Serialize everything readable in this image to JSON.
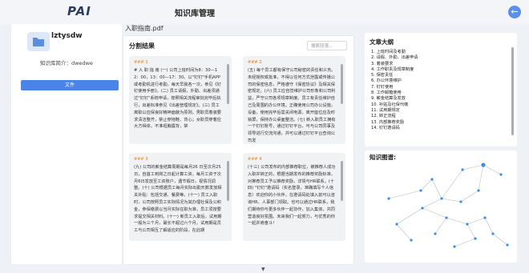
{
  "header": {
    "logo": "PAI",
    "title": "知识库管理",
    "back_icon": "arrow-left-icon"
  },
  "sidebar": {
    "kb_name": "lztysdw",
    "intro": "知识库简介：dwedwe",
    "file_button": "文件"
  },
  "main": {
    "file_name": "入职指南.pdf",
    "segment_title": "分割结果",
    "search_placeholder": "搜索段落...",
    "cards": [
      {
        "tag": "### 1",
        "text": "# 入 职 指 南 (一) 公司上班时间为8：30—12：00，13：00—17：30。以\"钉钉\"手机APP或考勤机进行考勤。每天早晨各一次，参见《钉钉使用手册》。(二) 员工请假，外勤、出差须通过\"钉钉\"系统申请，按照相关流程审批完毕后执行，出差标准参见《出差管理规定》。(三) 员工离职以应保良好精神面貌为原则。男职员着装要求清洁整齐，禁止穿拖鞋、背心；女职员穿着应大方得体，不准袒胸露背，禁"
      },
      {
        "tag": "### 2",
        "text": "(五) 每个员工都有保守公司秘密的责任和义务。未经授权或批准，不得以任何方式泄露或传播公司的保密信息，严格遵守《保密协议》及相关保密规定。(六) 员工应自觉维护公司形象和公司利益，严守公司各项规章制度。员工有责任维护自己及周围的办公环境。正确使用公司办公设施，设备，使用完毕后需关闭电源。离开座位应及时锁屏，保持办公桌面整洁。(七) 新入职员工拥有一个钉钉账号，通过钉钉平台，可与公司同事及领导进行交流沟通，并可以通过钉钉平台查询公司发"
      },
      {
        "tag": "### 3",
        "text": "(九) 公司的薪金结算周期是每月26 日至次月25 日，自首工到岗之日起计算工资，每月工资于次月6日发放至工资账户，遇节假日，视情况调整。(十) 公司根据员工每月实际出勤天数发放相关补贴：包括交通、餐费等。(十一) 员工入职时，公司按照员工实际情况为其办理社保及公积金，参保缴费以当月实际在职为准，员工须按要求提交相关材料。(十一) 新员工入职后，试用期一般为三个月，最长不超过六个月。试用期是员工与公司相互了解适应的阶段，在此期"
      },
      {
        "tag": "### 4",
        "text": "(十三) 公司发布的内部推荐职位，被推荐人成功入职并转正的，根据当期发布的推荐奖励标准，对推荐员工予以推荐奖励，详情与HR联系。(十四) \"钉钉\"邀请码（实名登录，准确填写个人信息）欢迎你的小伙伴，在邀请码处填入前可以咨询HR、人事部门领取。也可以通过HR联系，我们期待你与更多伙伴一起协作，加入集体，共同营造良好氛围。未来我们一起努力，与优秀的你一起并肩奋斗！"
      }
    ]
  },
  "outline": {
    "title": "文章大纲",
    "items": [
      "1. 上班时间及考勤",
      "2. 请假、外勤、出差申请",
      "3. 着装要求",
      "4. 工作职责及规章制度",
      "5. 保密责任",
      "6. 办公环境维护",
      "7. 钉钉使用",
      "8. 工作邮箱使用",
      "9. 薪金结算及发放",
      "10. 补贴及社保代缴",
      "11. 试用期规定",
      "12. 转正流程",
      "13. 内部推荐奖励",
      "14. 钉钉邀请码"
    ]
  },
  "graph": {
    "title": "知识图谱:",
    "colors": {
      "node": "#3d8de0",
      "edge": "#b8bcc4"
    }
  }
}
